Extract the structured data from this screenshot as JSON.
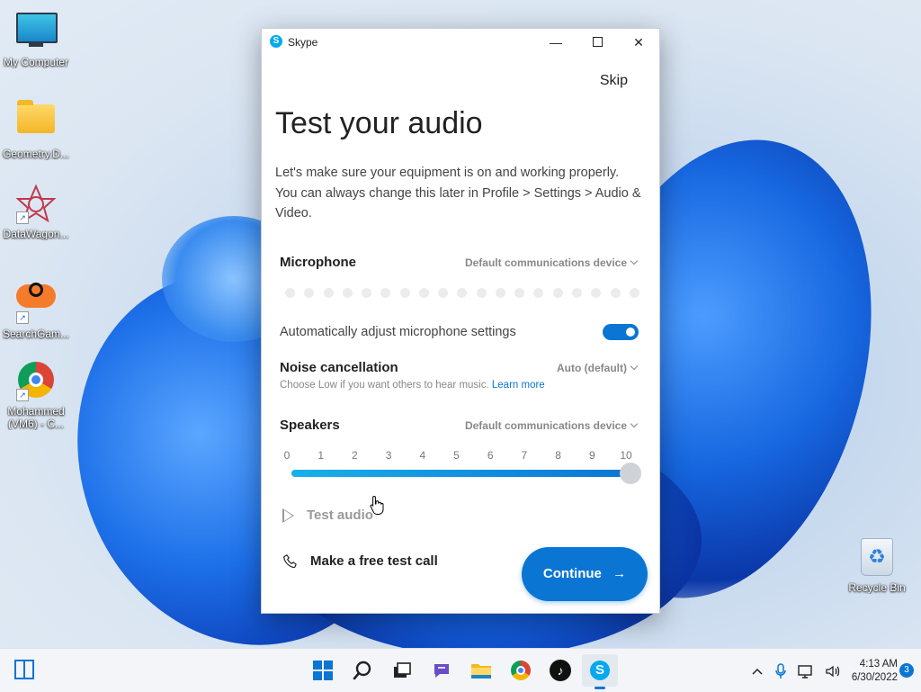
{
  "desktop": {
    "icons": [
      {
        "label": "My Computer"
      },
      {
        "label": "Geometry.D..."
      },
      {
        "label": "DataWagon..."
      },
      {
        "label": "SearchGam..."
      },
      {
        "label": "Mohammed (VM6) - C..."
      },
      {
        "label": "Recycle Bin"
      }
    ]
  },
  "window": {
    "app_title": "Skype",
    "app_icon_letter": "S",
    "controls": {
      "minimize": "—",
      "close": "✕"
    }
  },
  "setup": {
    "skip_label": "Skip",
    "title": "Test your audio",
    "intro": "Let's make sure your equipment is on and working properly. You can always change this later in Profile > Settings > Audio & Video.",
    "microphone": {
      "label": "Microphone",
      "device": "Default communications device",
      "level_dots": 19
    },
    "auto_adjust": {
      "label": "Automatically adjust microphone settings",
      "enabled": true
    },
    "noise": {
      "label": "Noise cancellation",
      "value": "Auto (default)",
      "help": "Choose Low if you want others to hear music.",
      "link": "Learn more"
    },
    "speakers": {
      "label": "Speakers",
      "device": "Default communications device",
      "ticks": [
        "0",
        "1",
        "2",
        "3",
        "4",
        "5",
        "6",
        "7",
        "8",
        "9",
        "10"
      ],
      "volume": 10,
      "volume_max": 10
    },
    "test_audio_label": "Test audio",
    "test_call_label": "Make a free test call",
    "continue_label": "Continue",
    "continue_arrow": "→"
  },
  "taskbar": {
    "time": "4:13 AM",
    "date": "6/30/2022",
    "notification_count": "3",
    "accent": "#0b75d4"
  }
}
